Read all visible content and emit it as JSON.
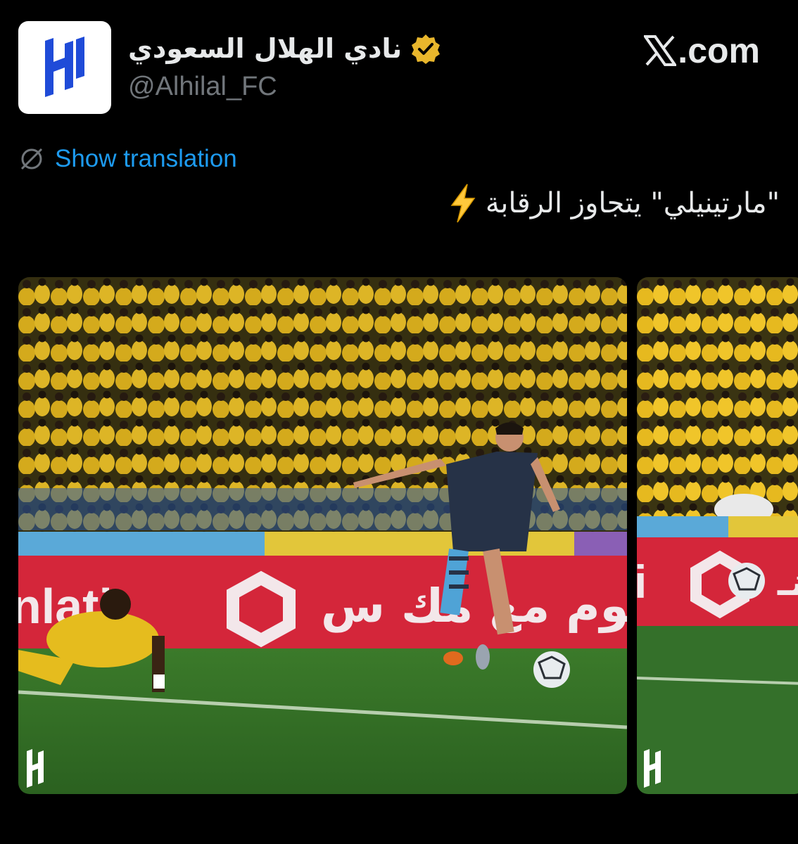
{
  "account": {
    "display_name": "نادي الهلال السعودي",
    "handle": "@Alhilal_FC",
    "verified": true,
    "verified_badge_color": "#e8b62c",
    "logo_color": "#1f4bd8"
  },
  "site": {
    "label": ".com",
    "brand_icon": "x-logo-icon"
  },
  "tweet": {
    "translate_label": "Show translation",
    "text": "\"مارتينيلي\" يتجاوز الرقابة",
    "emoji": "lightning-bolt-icon"
  },
  "media": {
    "count_visible": 2,
    "images": [
      {
        "description_icon": "match-photo",
        "board_text_left": "nlati",
        "board_text_right": "نوم مع مك س"
      },
      {
        "description_icon": "match-photo-2",
        "board_text_left": "i",
        "board_text_right": "نـ"
      }
    ]
  },
  "colors": {
    "background": "#000000",
    "text": "#e7e9ea",
    "muted": "#71767b",
    "link": "#1d9bf0"
  }
}
